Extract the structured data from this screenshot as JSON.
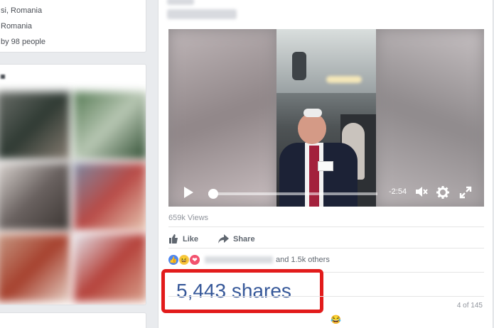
{
  "left_info": {
    "lines": [
      "si, Romania",
      "Romania",
      "by 98 people"
    ]
  },
  "post": {
    "video": {
      "time_remaining": "-2:54",
      "progress": 0.03,
      "icons": {
        "play": "play-icon",
        "mute": "mute-icon",
        "settings": "gear-icon",
        "fullscreen": "fullscreen-icon"
      }
    },
    "views": "659k Views",
    "actions": {
      "like": "Like",
      "share": "Share"
    },
    "reactions": {
      "others_text": "and 1.5k others",
      "icons": [
        "like-icon",
        "haha-icon",
        "love-icon"
      ]
    },
    "shares": "5,443 shares",
    "counter": "4 of 145"
  },
  "colors": {
    "highlight_border": "#e21b1b",
    "link_blue": "#365899",
    "page_bg": "#e9ebee"
  }
}
